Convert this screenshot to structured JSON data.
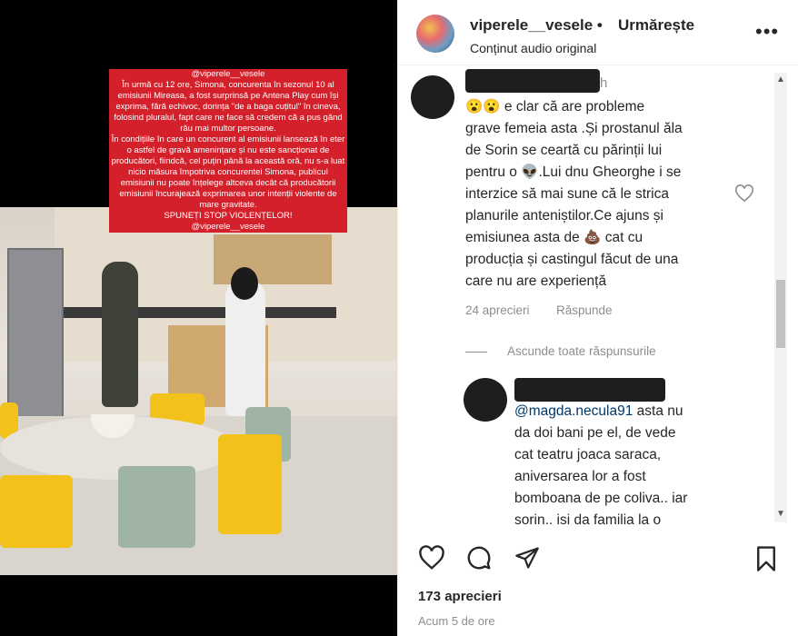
{
  "story": {
    "lines": [
      "@viperele__vesele",
      "În urmă cu 12 ore, Simona, concurenta în sezonul 10 al",
      "emisiunii Mireasa, a fost surprinsă pe Antena Play cum își",
      "exprima, fără echivoc, dorința \"de a baga cuțitul\" în cineva,",
      "folosind pluralul, fapt care ne face să credem că a pus gând",
      "rău mai multor persoane.",
      "În condițiile în care un concurent al emisiunii lansează în eter",
      "o astfel de gravă amenințare și nu este sancționat de",
      "producători, fiindcă, cel puțin până la această oră, nu s-a luat",
      "nicio măsura împotriva concurentei Simona, publicul",
      "emisiunii nu poate înțelege altceva decât că producătorii",
      "emisiunii încurajează exprimarea unor intenții violente de",
      "mare gravitate.",
      "SPUNEȚI STOP VIOLENȚELOR!",
      "@viperele__vesele"
    ]
  },
  "header": {
    "username": "viperele__vesele",
    "separator": "•",
    "follow_label": "Urmărește",
    "audio_label": "Conținut audio original",
    "more_icon": "more-horizontal-icon"
  },
  "comment1": {
    "time_suffix": "h",
    "text_lines": [
      "😮😮 e clar că are probleme",
      "grave femeia asta .Și prostanul ăla",
      "de Sorin se ceartă cu părinții lui",
      "pentru o 👽.Lui dnu Gheorghe i se",
      "interzice să mai sune că le strica",
      "planurile anteniștilor.Ce ajuns și",
      "emisiunea asta de 💩 cat cu",
      "producția și castingul făcut de una",
      "care nu are experiență"
    ],
    "likes_label": "24 aprecieri",
    "reply_label": "Răspunde",
    "hide_replies_label": "Ascunde toate răspunsurile"
  },
  "comment2": {
    "mention": "@magda.necula91",
    "text_lines_first": " asta nu",
    "text_lines": [
      "da doi bani pe el, de vede",
      "cat teatru joaca saraca,",
      "aniversarea lor a fost",
      "bomboana de pe coliva.. iar",
      "sorin.. isi da familia la o"
    ]
  },
  "footer": {
    "likes": "173 aprecieri",
    "time_ago": "Acum 5 de ore"
  },
  "colors": {
    "story_highlight": "#d4202a",
    "text": "#262626",
    "muted": "#8e8e8e",
    "mention": "#00376b"
  }
}
